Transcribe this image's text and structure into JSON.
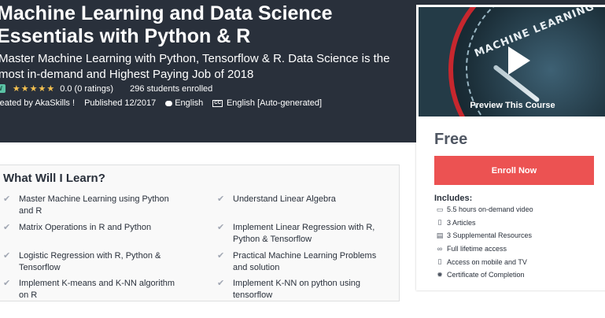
{
  "hero": {
    "title": "Machine Learning and Data Science Essentials with Python & R",
    "subtitle": "Master Machine Learning with Python, Tensorflow & R. Data Science is the most in-demand and Highest Paying Job of 2018",
    "badge": "EW",
    "stars": "★★★★★",
    "rating": "0.0 (0 ratings)",
    "enrolled": "296 students enrolled",
    "created_by": "reated by AkaSkills !",
    "published": "Published 12/2017",
    "language": "English",
    "captions_icon": "CC",
    "captions": "English [Auto-generated]"
  },
  "sidebar": {
    "preview_label": "Preview This Course",
    "preview_art_text": "MACHINE LEARNING",
    "price": "Free",
    "enroll_label": "Enroll Now",
    "includes_title": "Includes:",
    "includes": [
      {
        "icon": "video-icon",
        "text": "5.5 hours on-demand video"
      },
      {
        "icon": "article-icon",
        "text": "3 Articles"
      },
      {
        "icon": "file-icon",
        "text": "3 Supplemental Resources"
      },
      {
        "icon": "infinity-icon",
        "text": "Full lifetime access"
      },
      {
        "icon": "mobile-icon",
        "text": "Access on mobile and TV"
      },
      {
        "icon": "certificate-icon",
        "text": "Certificate of Completion"
      }
    ]
  },
  "learn": {
    "title": "What Will I Learn?",
    "items": [
      "Master Machine Learning using Python and R",
      "Understand Linear Algebra",
      "Matrix Operations in R and Python",
      "Implement Linear Regression with R, Python & Tensorflow",
      "Logistic Regression with R, Python & Tensorflow",
      "Practical Machine Learning Problems and solution",
      "Implement K-means and K-NN algorithm on R",
      "Implement K-NN on python using tensorflow"
    ]
  },
  "colors": {
    "hero_bg": "#29303b",
    "enroll_bg": "#ec5252",
    "star": "#f4c150",
    "badge": "#5bc3a6"
  }
}
